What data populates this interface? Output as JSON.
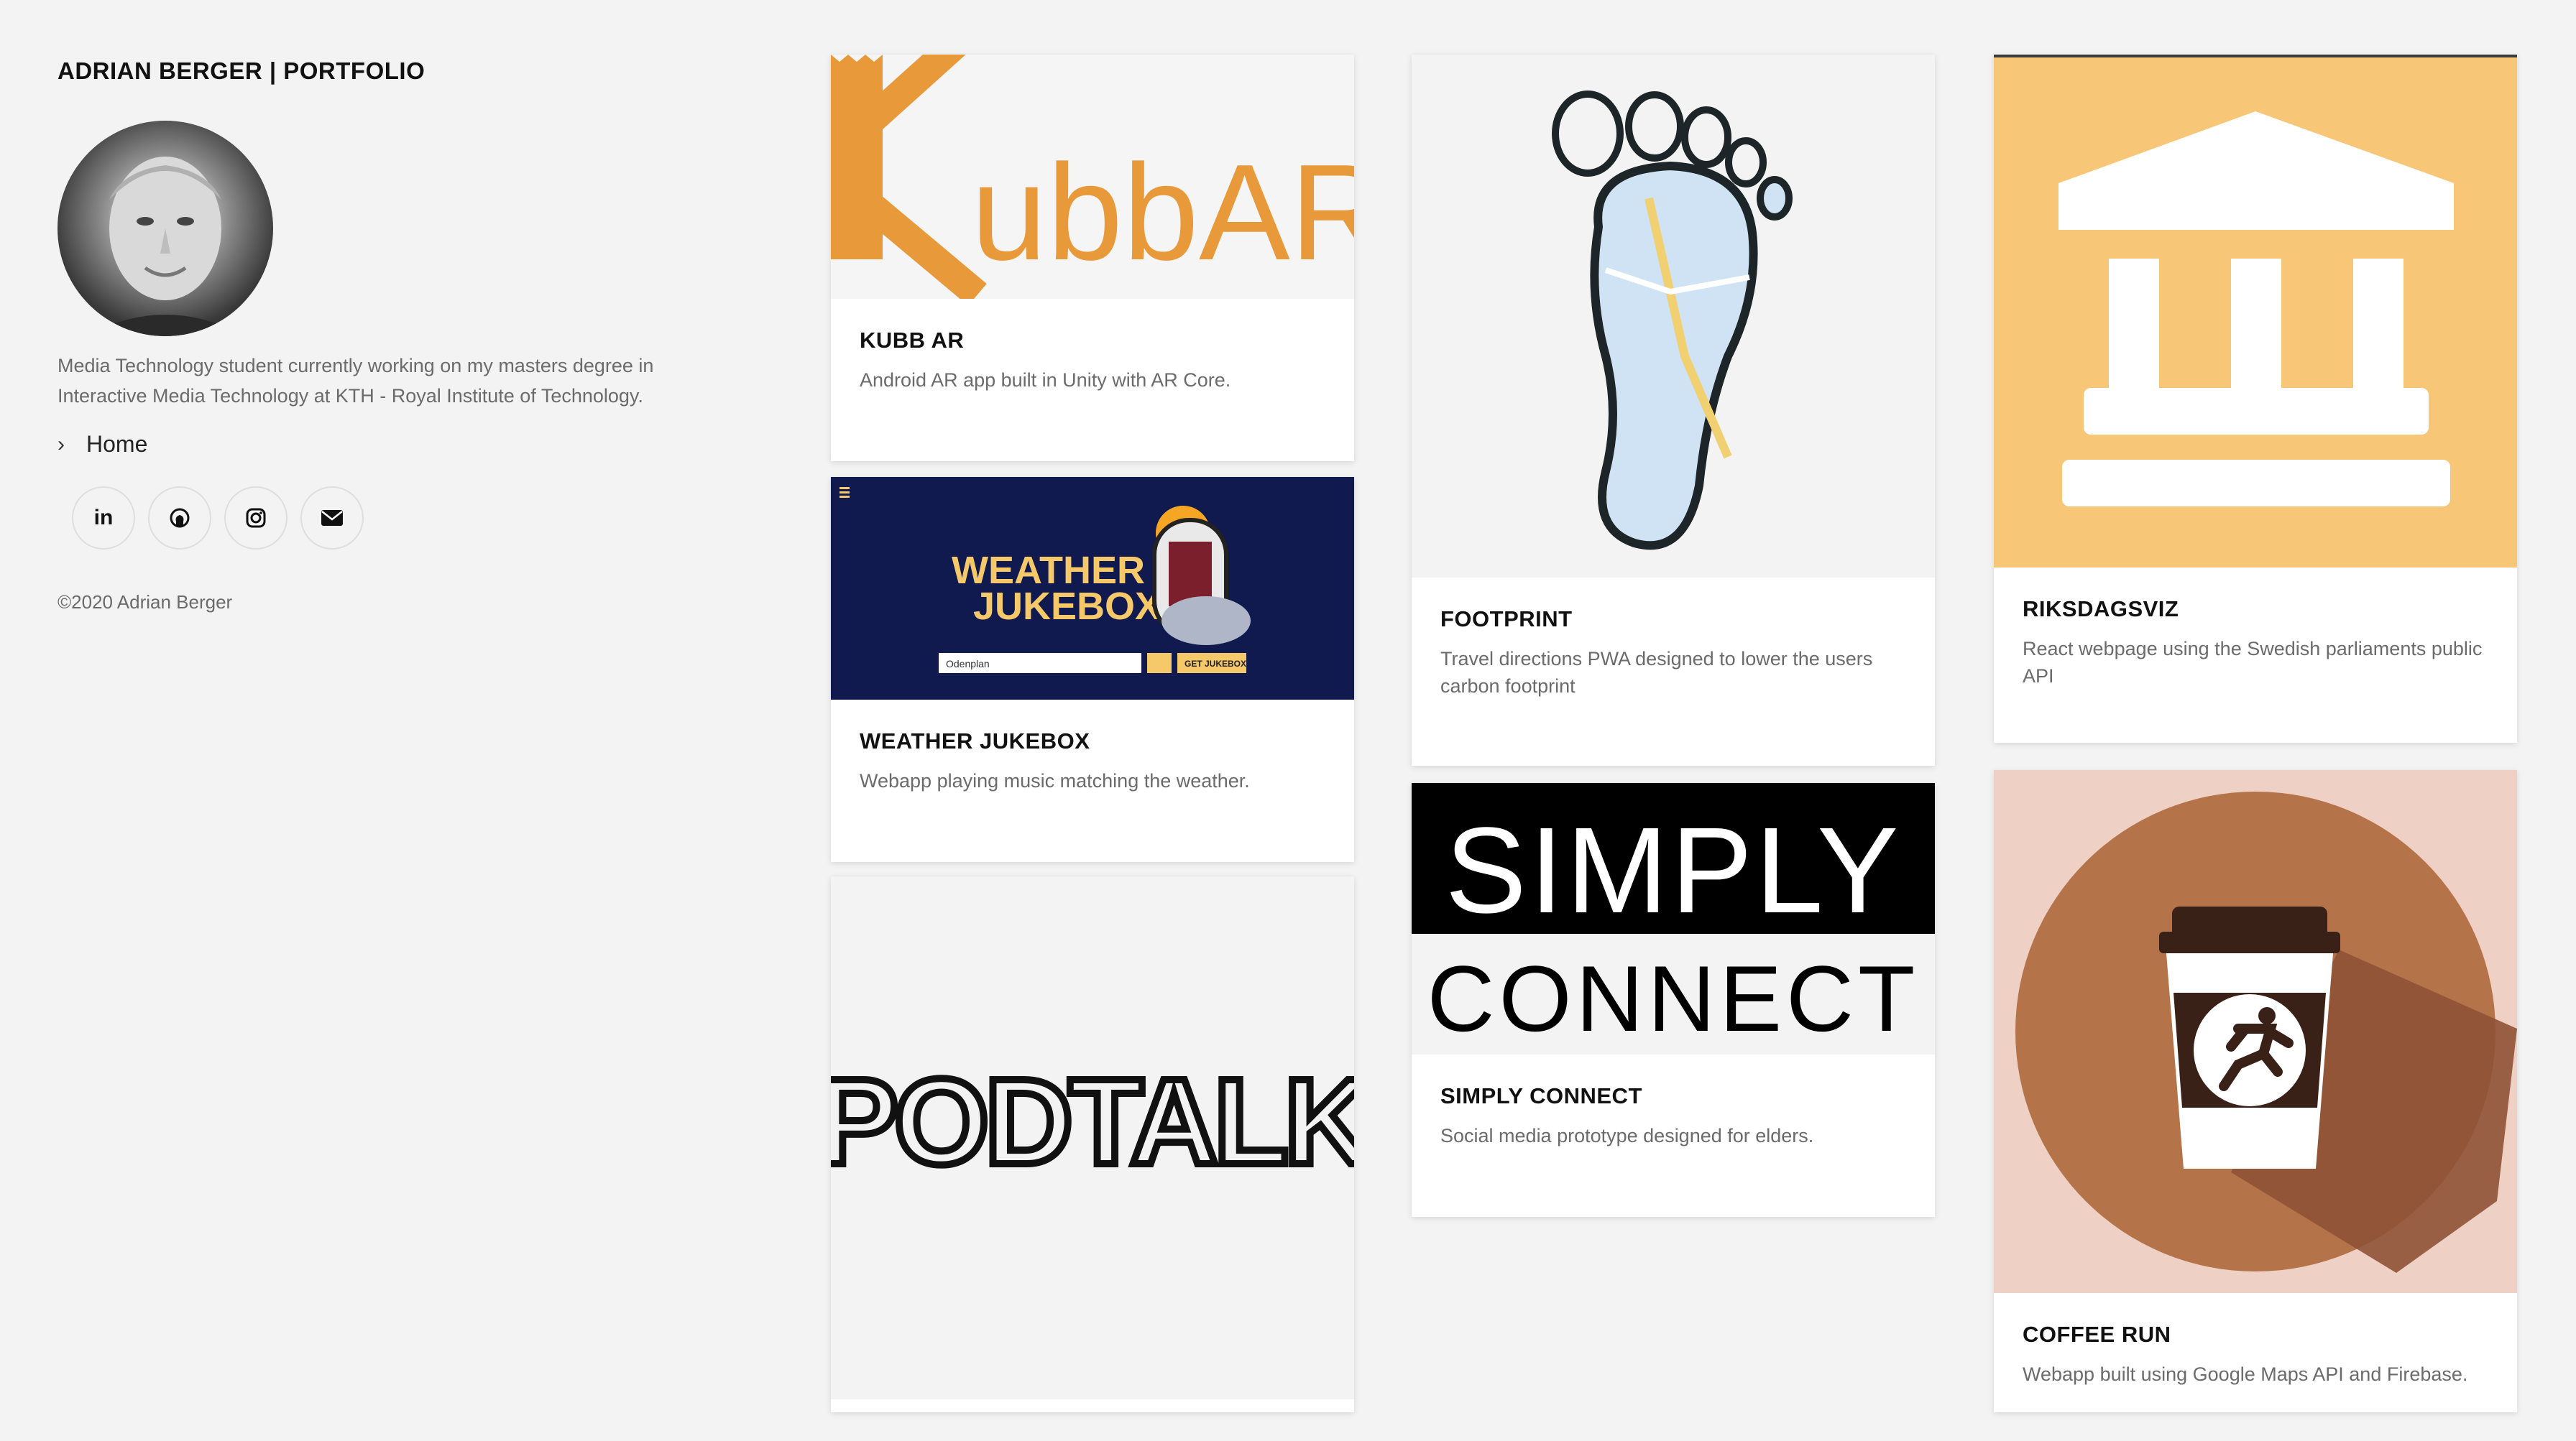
{
  "sidebar": {
    "title": "ADRIAN BERGER | PORTFOLIO",
    "bio": "Media Technology student currently working on my masters degree in Interactive Media Technology at KTH - Royal Institute of Technology.",
    "nav_home": "Home",
    "social": [
      {
        "icon": "linkedin-icon",
        "glyph": "in"
      },
      {
        "icon": "github-icon",
        "glyph": ""
      },
      {
        "icon": "instagram-icon",
        "glyph": ""
      },
      {
        "icon": "email-icon",
        "glyph": ""
      }
    ],
    "copyright": "©2020 Adrian Berger"
  },
  "projects": [
    {
      "title": "KUBB AR",
      "desc": "Android AR app built in Unity with AR Core.",
      "logo_text": "ubbAR",
      "accent": "#e8993a"
    },
    {
      "title": "WEATHER JUKEBOX",
      "desc": "Webapp playing music matching the weather.",
      "logo_line1": "WEATHER",
      "logo_line2": "JUKEBOX",
      "input_text": "Odenplan",
      "button_text": "GET JUKEBOX",
      "bg": "#111a4f",
      "accent": "#f5c86a"
    },
    {
      "title": "PODTALK",
      "desc": "",
      "logo_text": "PODTALK"
    },
    {
      "title": "FOOTPRINT",
      "desc": "Travel directions PWA designed to lower the users carbon footprint"
    },
    {
      "title": "SIMPLY CONNECT",
      "desc": "Social media prototype designed for elders.",
      "logo_line1": "SIMPLY",
      "logo_line2": "CONNECT"
    },
    {
      "title": "RIKSDAGSVIZ",
      "desc": "React webpage using the Swedish parliaments public API",
      "bg": "#f7c677"
    },
    {
      "title": "COFFEE RUN",
      "desc": "Webapp built using Google Maps API and Firebase.",
      "bg": "#efd0c4",
      "accent": "#b5734a"
    }
  ]
}
